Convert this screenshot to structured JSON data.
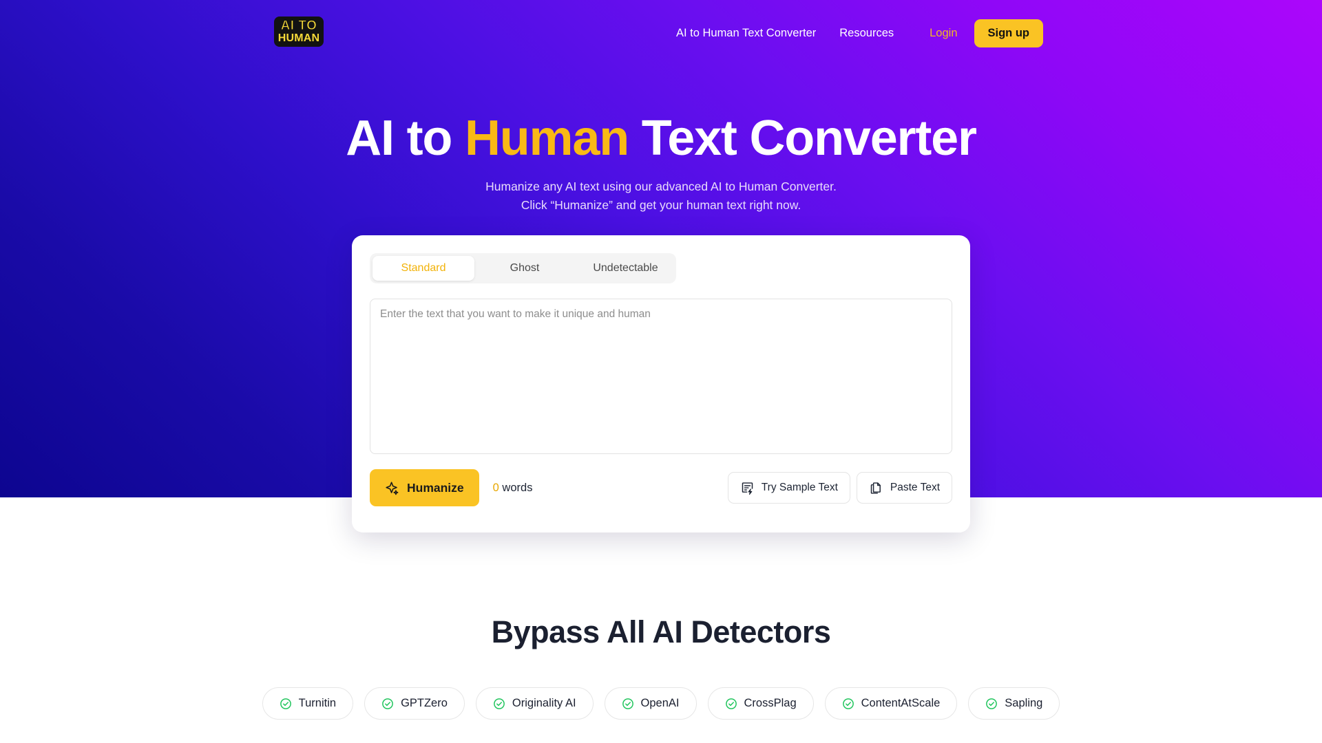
{
  "header": {
    "logo": {
      "line1": "AI TO",
      "line2": "HUMAN",
      "name": "aitohuman-logo"
    },
    "nav": [
      {
        "label": "AI to Human Text Converter",
        "name": "nav-converter"
      },
      {
        "label": "Resources",
        "name": "nav-resources"
      }
    ],
    "login_label": "Login",
    "signup_label": "Sign up"
  },
  "hero": {
    "title_part1": "AI to ",
    "title_accent": "Human",
    "title_part2": " Text Converter",
    "subtitle_line1": "Humanize any AI text using our advanced AI to Human Converter.",
    "subtitle_line2": "Click “Humanize” and get your human text right now."
  },
  "converter": {
    "tabs": [
      {
        "label": "Standard",
        "active": true
      },
      {
        "label": "Ghost",
        "active": false
      },
      {
        "label": "Undetectable",
        "active": false
      }
    ],
    "textarea_value": "",
    "textarea_placeholder": "Enter the text that you want to make it unique and human",
    "humanize_label": "Humanize",
    "word_count_number": "0",
    "word_count_label": " words",
    "try_sample_label": "Try Sample Text",
    "paste_label": "Paste Text"
  },
  "detectors": {
    "title": "Bypass All AI Detectors",
    "chips": [
      {
        "label": "Turnitin"
      },
      {
        "label": "GPTZero"
      },
      {
        "label": "Originality AI"
      },
      {
        "label": "OpenAI"
      },
      {
        "label": "CrossPlag"
      },
      {
        "label": "ContentAtScale"
      },
      {
        "label": "Sapling"
      }
    ]
  },
  "colors": {
    "brand_yellow": "#fac324",
    "accent_gold": "#f9b915",
    "gradient_start": "#0d0590",
    "gradient_end": "#ac06fb",
    "check_green": "#22c55e",
    "heading_dark": "#1b2030"
  }
}
